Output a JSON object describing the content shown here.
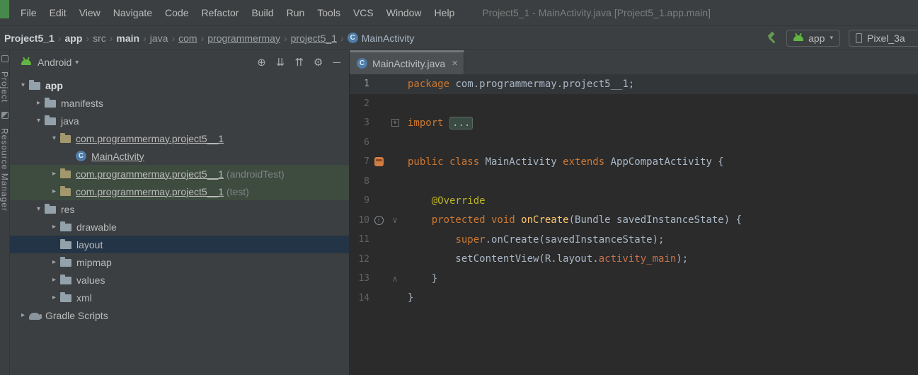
{
  "menubar": {
    "items": [
      "File",
      "Edit",
      "View",
      "Navigate",
      "Code",
      "Refactor",
      "Build",
      "Run",
      "Tools",
      "VCS",
      "Window",
      "Help"
    ],
    "window_title": "Project5_1 - MainActivity.java [Project5_1.app.main]"
  },
  "navbar": {
    "breadcrumbs": [
      {
        "label": "Project5_1",
        "style": "bright"
      },
      {
        "label": "app",
        "style": "bright"
      },
      {
        "label": "src",
        "style": "dim"
      },
      {
        "label": "main",
        "style": "bright"
      },
      {
        "label": "java",
        "style": "dim"
      },
      {
        "label": "com",
        "style": "dim-underline"
      },
      {
        "label": "programmermay",
        "style": "dim-underline"
      },
      {
        "label": "project5_1",
        "style": "dim-underline"
      },
      {
        "label": "MainActivity",
        "style": "class",
        "icon": "class"
      }
    ],
    "run_config_label": "app",
    "device_label": "Pixel_3a"
  },
  "tool_window_stripe": {
    "top": "Project",
    "bottom": "Resource Manager"
  },
  "project_panel": {
    "view_selector_label": "Android",
    "tree": [
      {
        "depth": 0,
        "chevron": "down",
        "icon": "folder",
        "label": "app",
        "bold": true
      },
      {
        "depth": 1,
        "chevron": "right",
        "icon": "folder",
        "label": "manifests"
      },
      {
        "depth": 1,
        "chevron": "down",
        "icon": "folder",
        "label": "java"
      },
      {
        "depth": 2,
        "chevron": "down",
        "icon": "package",
        "label": "com.programmermay.project5__1",
        "underline": true
      },
      {
        "depth": 3,
        "icon": "class",
        "label": "MainActivity",
        "underline": true
      },
      {
        "depth": 2,
        "chevron": "right",
        "icon": "package",
        "label": "com.programmermay.project5__1",
        "suffix": " (androidTest)",
        "underline": true,
        "highlight": "green"
      },
      {
        "depth": 2,
        "chevron": "right",
        "icon": "package",
        "label": "com.programmermay.project5__1",
        "suffix": " (test)",
        "underline": true,
        "highlight": "green"
      },
      {
        "depth": 1,
        "chevron": "down",
        "icon": "folder",
        "label": "res"
      },
      {
        "depth": 2,
        "chevron": "right",
        "icon": "folder",
        "label": "drawable"
      },
      {
        "depth": 2,
        "icon": "folder",
        "label": "layout",
        "highlight": "selected"
      },
      {
        "depth": 2,
        "chevron": "right",
        "icon": "folder",
        "label": "mipmap"
      },
      {
        "depth": 2,
        "chevron": "right",
        "icon": "folder",
        "label": "values"
      },
      {
        "depth": 2,
        "chevron": "right",
        "icon": "folder",
        "label": "xml"
      },
      {
        "depth": 0,
        "chevron": "right",
        "icon": "gradle",
        "label": "Gradle Scripts"
      }
    ]
  },
  "editor": {
    "tab_title": "MainActivity.java",
    "lines": [
      {
        "num": "1",
        "caret": true,
        "segments": [
          {
            "t": "package ",
            "c": "kw"
          },
          {
            "t": "com.programmermay.project5__1;",
            "c": "pl"
          }
        ]
      },
      {
        "num": "2",
        "segments": []
      },
      {
        "num": "3",
        "fold": "plus",
        "segments": [
          {
            "t": "import ",
            "c": "kw"
          },
          {
            "t": "...",
            "c": "fold"
          }
        ]
      },
      {
        "num": "6",
        "segments": []
      },
      {
        "num": "7",
        "icon": "android",
        "segments": [
          {
            "t": "public class ",
            "c": "kw"
          },
          {
            "t": "MainActivity ",
            "c": "pl"
          },
          {
            "t": "extends ",
            "c": "kw"
          },
          {
            "t": "AppCompatActivity {",
            "c": "pl"
          }
        ]
      },
      {
        "num": "8",
        "segments": []
      },
      {
        "num": "9",
        "segments": [
          {
            "t": "    ",
            "c": "pl"
          },
          {
            "t": "@Override",
            "c": "ann"
          }
        ]
      },
      {
        "num": "10",
        "icon": "override",
        "fold": "down",
        "segments": [
          {
            "t": "    ",
            "c": "pl"
          },
          {
            "t": "protected void ",
            "c": "kw"
          },
          {
            "t": "onCreate",
            "c": "fn"
          },
          {
            "t": "(Bundle savedInstanceState) {",
            "c": "pl"
          }
        ]
      },
      {
        "num": "11",
        "segments": [
          {
            "t": "        ",
            "c": "pl"
          },
          {
            "t": "super",
            "c": "kw"
          },
          {
            "t": ".onCreate(savedInstanceState);",
            "c": "pl"
          }
        ]
      },
      {
        "num": "12",
        "segments": [
          {
            "t": "        setContentView(R.layout.",
            "c": "pl"
          },
          {
            "t": "activity_main",
            "c": "res"
          },
          {
            "t": ");",
            "c": "pl"
          }
        ]
      },
      {
        "num": "13",
        "fold": "up",
        "segments": [
          {
            "t": "    }",
            "c": "pl"
          }
        ]
      },
      {
        "num": "14",
        "segments": [
          {
            "t": "}",
            "c": "pl"
          }
        ]
      }
    ]
  }
}
